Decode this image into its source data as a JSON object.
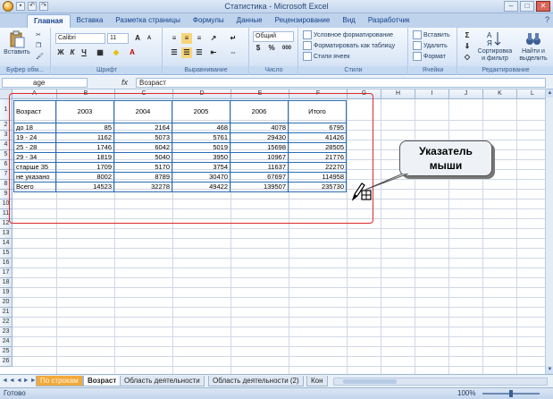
{
  "window": {
    "title": "Статистика - Microsoft Excel",
    "minimize": "–",
    "maximize": "□",
    "close": "✕"
  },
  "ribbon_tabs": [
    "Главная",
    "Вставка",
    "Разметка страницы",
    "Формулы",
    "Данные",
    "Рецензирование",
    "Вид",
    "Разработчик"
  ],
  "ribbon": {
    "clipboard": {
      "paste": "Вставить",
      "label": "Буфер обм..."
    },
    "font": {
      "name": "Calibri",
      "size": "11",
      "label": "Шрифт",
      "bold": "Ж",
      "italic": "К",
      "underline": "Ч"
    },
    "alignment": {
      "label": "Выравнивание"
    },
    "number": {
      "format": "Общий",
      "label": "Число",
      "percent": "%",
      "thousands": "000"
    },
    "styles": {
      "conditional": "Условное форматирование",
      "as_table": "Форматировать как таблицу",
      "cell_styles": "Стили ячеек",
      "label": "Стили"
    },
    "cells": {
      "insert": "Вставить",
      "delete": "Удалить",
      "format": "Формат",
      "label": "Ячейки"
    },
    "editing": {
      "sort": "Сортировка и фильтр",
      "find": "Найти и выделить",
      "label": "Редактирование"
    }
  },
  "formula_bar": {
    "name_box": "age",
    "fx": "fx",
    "formula": "Возраст"
  },
  "columns": [
    "A",
    "B",
    "C",
    "D",
    "E",
    "F",
    "G",
    "H",
    "I",
    "J",
    "K",
    "L"
  ],
  "rows": [
    "1",
    "2",
    "3",
    "4",
    "5",
    "6",
    "7",
    "8",
    "9",
    "10",
    "11",
    "12",
    "13",
    "14",
    "15",
    "16",
    "17",
    "18",
    "19",
    "20",
    "21",
    "22",
    "23",
    "24",
    "25",
    "26"
  ],
  "table": {
    "headers": [
      "Возраст",
      "2003",
      "2004",
      "2005",
      "2006",
      "Итого"
    ],
    "rows": [
      [
        "до 18",
        "85",
        "2164",
        "468",
        "4078",
        "6795"
      ],
      [
        "19 - 24",
        "1162",
        "5073",
        "5761",
        "29430",
        "41426"
      ],
      [
        "25 - 28",
        "1746",
        "6042",
        "5019",
        "15698",
        "28505"
      ],
      [
        "29 - 34",
        "1819",
        "5040",
        "3950",
        "10967",
        "21776"
      ],
      [
        "старше 35",
        "1709",
        "5170",
        "3754",
        "11637",
        "22270"
      ],
      [
        "не указано",
        "8002",
        "8789",
        "30470",
        "67697",
        "114958"
      ],
      [
        "Всего",
        "14523",
        "32278",
        "49422",
        "139507",
        "235730"
      ]
    ]
  },
  "callout": {
    "line1": "Указатель",
    "line2": "мыши"
  },
  "sheet_tabs": [
    "По строкам",
    "Возраст",
    "Область деятельности",
    "Область деятельности (2)",
    "Кон"
  ],
  "status": {
    "ready": "Готово",
    "zoom": "100%"
  },
  "colors": {
    "accent": "#2a6db0",
    "frame": "#e0282a"
  }
}
